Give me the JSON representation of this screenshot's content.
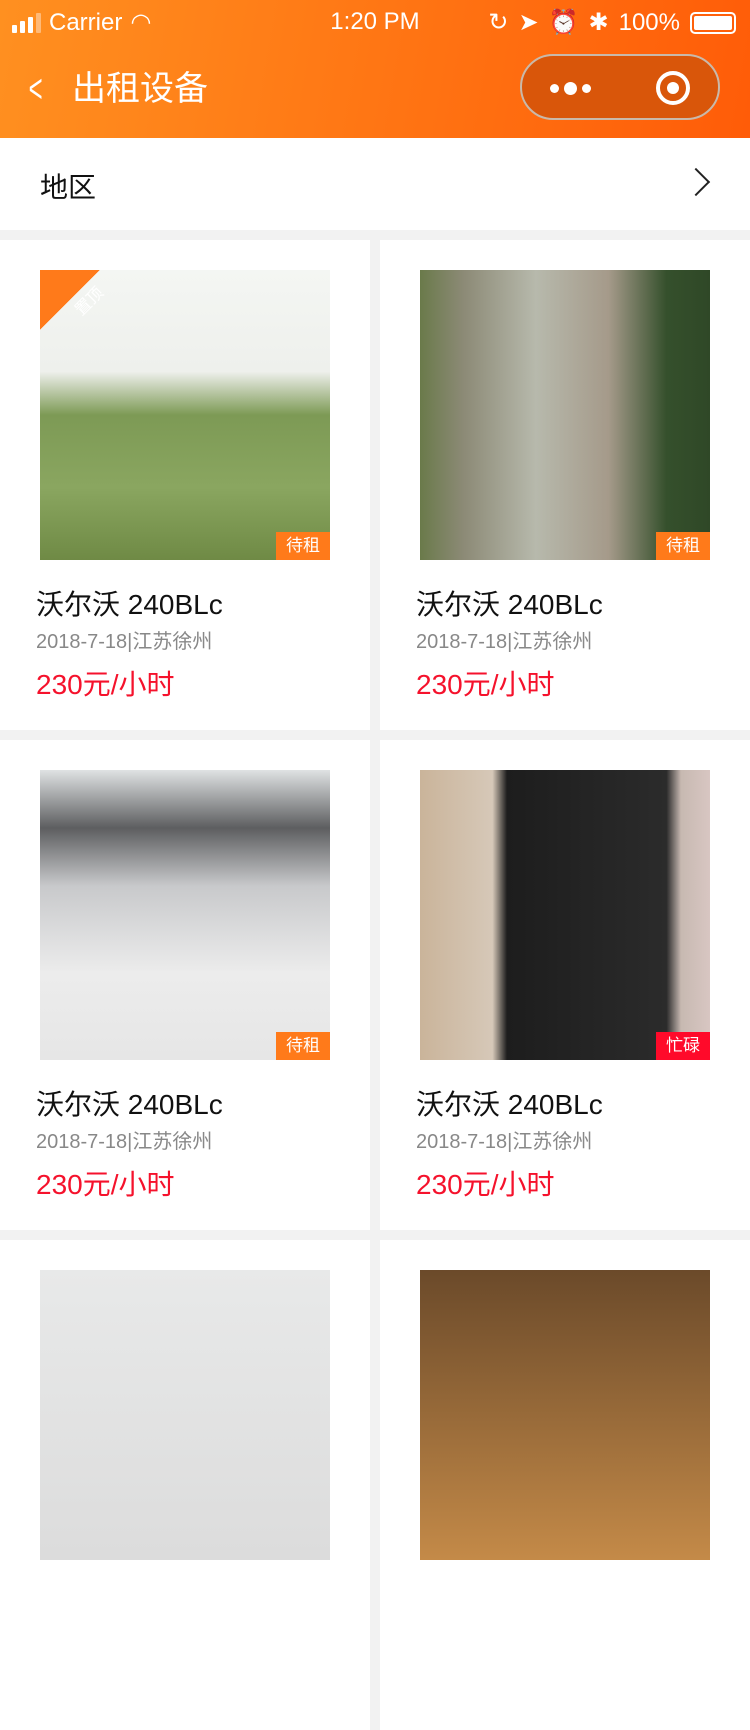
{
  "status_bar": {
    "carrier": "Carrier",
    "time": "1:20 PM",
    "battery": "100%"
  },
  "header": {
    "title": "出租设备"
  },
  "region": {
    "label": "地区"
  },
  "pin_label": "置顶",
  "items": [
    {
      "name": "沃尔沃 240BLc",
      "meta": "2018-7-18|江苏徐州",
      "price": "230元/小时",
      "status": "待租",
      "pinned": true,
      "busy": false,
      "bg": "linear-gradient(180deg,#f4f6f3 0%,#eef0ec 35%,#7d9a55 50%,#8aa660 75%,#6f8a45 100%)"
    },
    {
      "name": "沃尔沃 240BLc",
      "meta": "2018-7-18|江苏徐州",
      "price": "230元/小时",
      "status": "待租",
      "pinned": false,
      "busy": false,
      "bg": "linear-gradient(90deg,#6a7a4a 0%,#8c8a76 15%,#b7b9ac 40%,#a59a8a 65%,#35502c 85%,#2f4827 100%)"
    },
    {
      "name": "沃尔沃 240BLc",
      "meta": "2018-7-18|江苏徐州",
      "price": "230元/小时",
      "status": "待租",
      "pinned": false,
      "busy": false,
      "bg": "linear-gradient(180deg,#dfe2e3 0%,#5d5e60 20%,#c8c9cb 40%,#ececec 70%,#e6e6e6 100%)"
    },
    {
      "name": "沃尔沃 240BLc",
      "meta": "2018-7-18|江苏徐州",
      "price": "230元/小时",
      "status": "忙碌",
      "pinned": false,
      "busy": true,
      "bg": "linear-gradient(90deg,#cab49a 0%,#d6c8b8 25%,#1d1d1d 30%,#2b2b2b 85%,#c7b9b1 90%,#d8c6c2 100%)"
    },
    {
      "bg": "linear-gradient(180deg,#e8e9e9,#dcdcdc)"
    },
    {
      "bg": "linear-gradient(180deg,#6b4a2a,#c48a48)"
    }
  ]
}
